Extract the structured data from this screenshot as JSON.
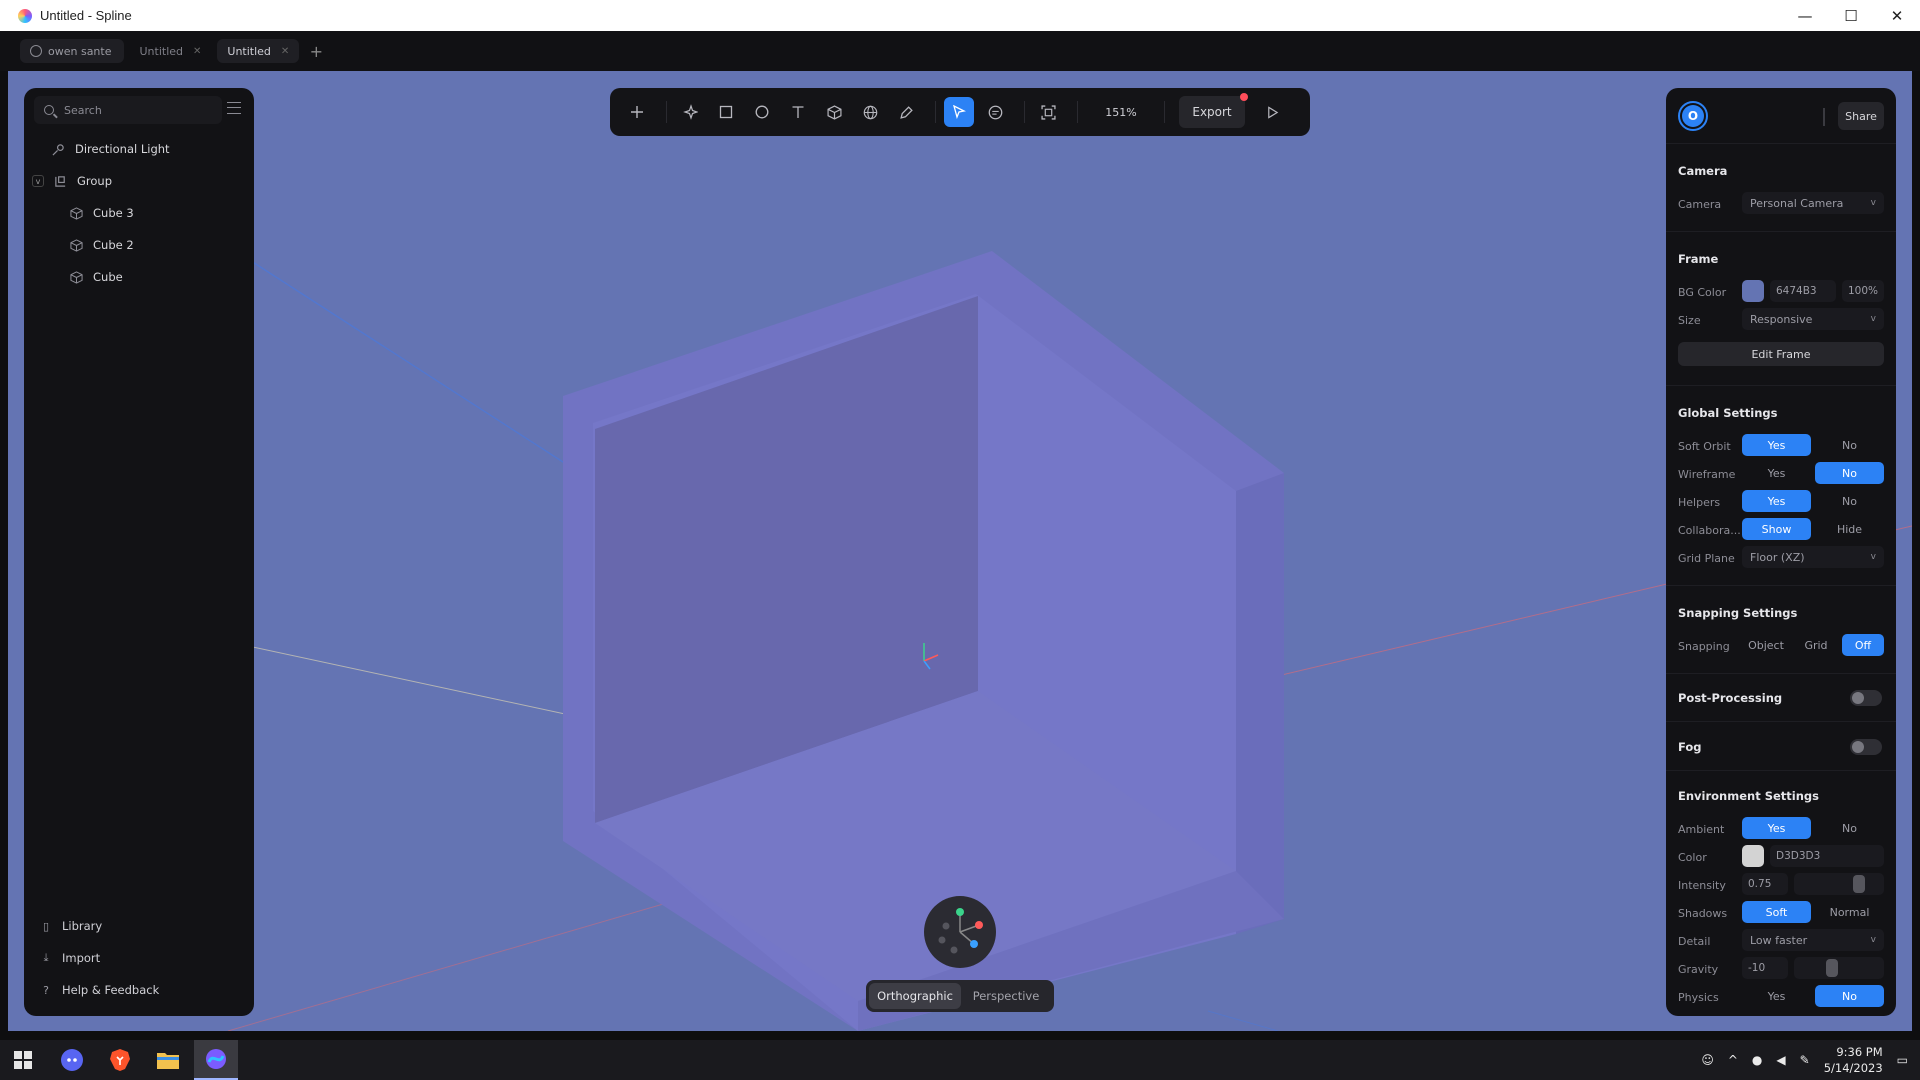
{
  "window": {
    "title": "Untitled - Spline",
    "controls": [
      "—",
      "☐",
      "✕"
    ]
  },
  "tabs": {
    "user": "owen sante",
    "items": [
      {
        "label": "Untitled",
        "active": false
      },
      {
        "label": "Untitled",
        "active": true
      }
    ],
    "add_label": "+"
  },
  "left_panel": {
    "search_placeholder": "Search",
    "tree": [
      {
        "label": "Directional Light",
        "icon": "light-icon",
        "depth": 1
      },
      {
        "label": "Group",
        "icon": "group-icon",
        "depth": 0,
        "expanded": true
      },
      {
        "label": "Cube 3",
        "icon": "cube-icon",
        "depth": 2
      },
      {
        "label": "Cube 2",
        "icon": "cube-icon",
        "depth": 2
      },
      {
        "label": "Cube",
        "icon": "cube-icon",
        "depth": 2
      }
    ],
    "bottom_links": [
      {
        "label": "Library",
        "icon": "library-icon"
      },
      {
        "label": "Import",
        "icon": "import-icon"
      },
      {
        "label": "Help & Feedback",
        "icon": "help-icon"
      }
    ]
  },
  "toolbar": {
    "zoom": "151%",
    "export_label": "Export"
  },
  "right_panel": {
    "avatar_initial": "O",
    "share_label": "Share",
    "camera": {
      "title": "Camera",
      "label": "Camera",
      "value": "Personal Camera"
    },
    "frame": {
      "title": "Frame",
      "bg_label": "BG Color",
      "bg_hex": "6474B3",
      "bg_opacity": "100%",
      "bg_color": "#6474B3",
      "size_label": "Size",
      "size_value": "Responsive",
      "edit_label": "Edit Frame"
    },
    "global": {
      "title": "Global Settings",
      "soft_orbit": {
        "label": "Soft Orbit",
        "yes": "Yes",
        "no": "No",
        "on": "yes"
      },
      "wireframe": {
        "label": "Wireframe",
        "yes": "Yes",
        "no": "No",
        "on": "no"
      },
      "helpers": {
        "label": "Helpers",
        "yes": "Yes",
        "no": "No",
        "on": "yes"
      },
      "collab": {
        "label": "Collabora...",
        "yes": "Show",
        "no": "Hide",
        "on": "yes"
      },
      "grid_plane": {
        "label": "Grid Plane",
        "value": "Floor (XZ)"
      }
    },
    "snapping": {
      "title": "Snapping Settings",
      "label": "Snapping",
      "options": [
        "Object",
        "Grid",
        "Off"
      ],
      "on": "Off"
    },
    "post_processing": {
      "title": "Post-Processing",
      "enabled": false
    },
    "fog": {
      "title": "Fog",
      "enabled": false
    },
    "environment": {
      "title": "Environment Settings",
      "ambient": {
        "label": "Ambient",
        "yes": "Yes",
        "no": "No",
        "on": "yes"
      },
      "color": {
        "label": "Color",
        "hex": "D3D3D3",
        "color": "#D3D3D3"
      },
      "intensity": {
        "label": "Intensity",
        "value": "0.75",
        "level": 0.75
      },
      "shadows": {
        "label": "Shadows",
        "yes": "Soft",
        "no": "Normal",
        "on": "yes"
      },
      "detail": {
        "label": "Detail",
        "value": "Low faster"
      },
      "gravity": {
        "label": "Gravity",
        "value": "-10",
        "level": 0.4
      },
      "physics": {
        "label": "Physics",
        "yes": "Yes",
        "no": "No",
        "on": "no"
      }
    }
  },
  "view": {
    "orthographic": "Orthographic",
    "perspective": "Perspective",
    "active": "orthographic"
  },
  "taskbar": {
    "time": "9:36 PM",
    "date": "5/14/2023"
  }
}
